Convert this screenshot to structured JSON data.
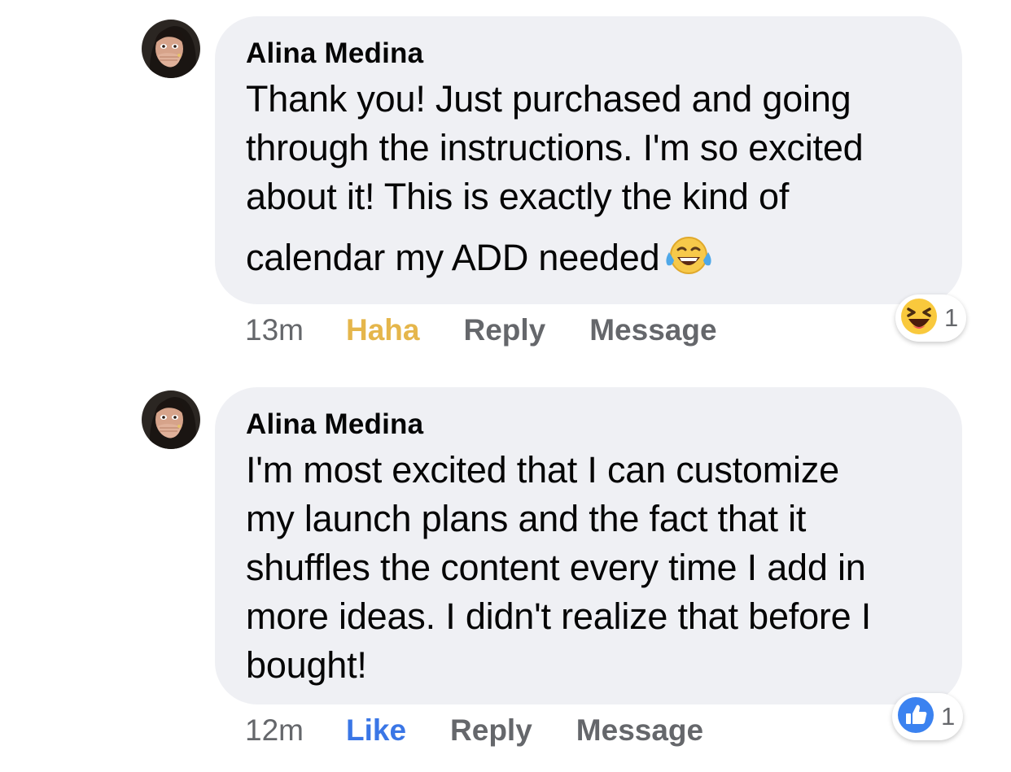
{
  "comments": [
    {
      "author": "Alina Medina",
      "text": "Thank you! Just purchased and going through the instructions. I'm so excited about it! This is exactly the kind of calendar my ADD needed",
      "lines": [
        "Thank you! Just purchased and going",
        "through the instructions. I'm so excited",
        "about it! This is exactly the kind of",
        "calendar my ADD needed"
      ],
      "inline_emoji": "tears-of-joy-emoji",
      "time": "13m",
      "reaction_action": "Haha",
      "reply_label": "Reply",
      "message_label": "Message",
      "reaction_icon": "haha-reaction-icon",
      "reaction_count": "1"
    },
    {
      "author": "Alina Medina",
      "text": "I'm most excited that I can customize my launch plans and the fact that it shuffles the content every time I add in more ideas. I didn't realize that before I bought!",
      "lines": [
        "I'm most excited that I can customize",
        "my launch plans and the fact that it",
        "shuffles the content every time I add in",
        "more ideas. I didn't realize that before I",
        "bought!"
      ],
      "time": "12m",
      "reaction_action": "Like",
      "reply_label": "Reply",
      "message_label": "Message",
      "reaction_icon": "like-reaction-icon",
      "reaction_count": "1"
    }
  ],
  "colors": {
    "bubble": "#eff0f4",
    "meta_text": "#65676b",
    "haha_active": "#e5b64b",
    "like_active": "#3a76e6"
  }
}
